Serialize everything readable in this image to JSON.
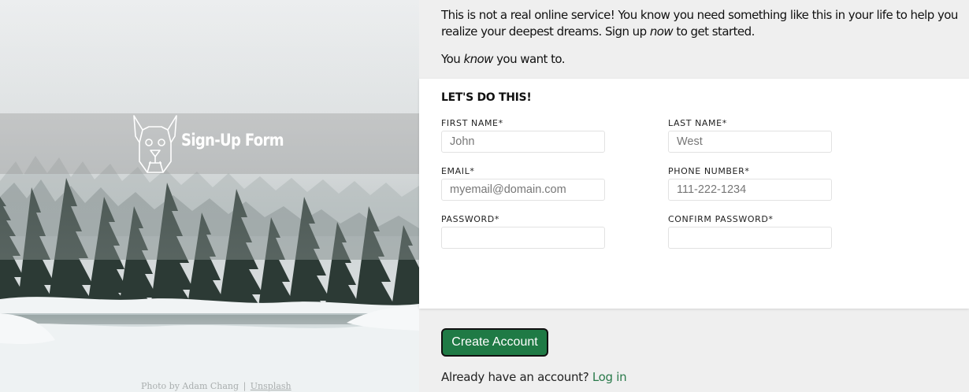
{
  "hero": {
    "brand_title": "Sign-Up Form",
    "logo_icon": "dog-head-icon",
    "credit": {
      "prefix": "Photo by Adam Chang",
      "separator": "|",
      "link": "Unsplash"
    }
  },
  "intro": {
    "p1_before": "This is not a real online service! You know you need something like this in your life to help you realize your deepest dreams. Sign up",
    "p1_em": "now",
    "p1_after": "to get started.",
    "p2_before": "You",
    "p2_em": "know",
    "p2_after": "you want to."
  },
  "form": {
    "heading": "LET'S DO THIS!",
    "fields": {
      "first_name": {
        "label": "FIRST NAME*",
        "placeholder": "John",
        "value": ""
      },
      "last_name": {
        "label": "LAST NAME*",
        "placeholder": "West",
        "value": ""
      },
      "email": {
        "label": "EMAIL*",
        "placeholder": "myemail@domain.com",
        "value": ""
      },
      "phone": {
        "label": "PHONE NUMBER*",
        "placeholder": "111-222-1234",
        "value": ""
      },
      "password": {
        "label": "PASSWORD*",
        "placeholder": "",
        "value": ""
      },
      "confirm_password": {
        "label": "CONFIRM PASSWORD*",
        "placeholder": "",
        "value": ""
      }
    }
  },
  "actions": {
    "create_label": "Create Account",
    "login_prompt": "Already have an account?",
    "login_link": "Log in"
  },
  "colors": {
    "accent_green": "#1f7a45",
    "link_green": "#2a7a4b",
    "page_bg": "#efefef",
    "card_bg": "#ffffff"
  }
}
